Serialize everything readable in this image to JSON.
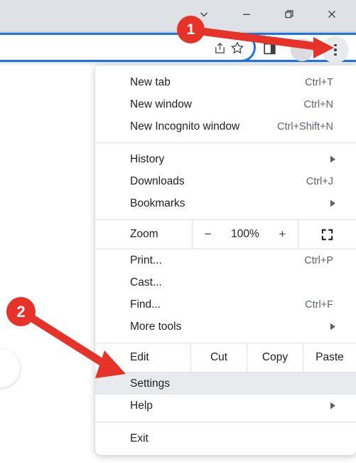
{
  "window_controls": [
    {
      "name": "tab-search-chevron",
      "icon": "chevron-down-icon"
    },
    {
      "name": "minimize",
      "icon": "minimize-icon"
    },
    {
      "name": "restore",
      "icon": "restore-icon"
    },
    {
      "name": "close",
      "icon": "close-icon"
    }
  ],
  "toolbar": {
    "share_icon": "share-icon",
    "bookmark_icon": "star-icon",
    "side_panel_icon": "side-panel-icon",
    "avatar_icon": "profile-avatar-icon",
    "menu_icon": "three-dot-menu-icon"
  },
  "menu": {
    "groups": [
      {
        "items": [
          {
            "label": "New tab",
            "accel": "Ctrl+T",
            "submenu": false
          },
          {
            "label": "New window",
            "accel": "Ctrl+N",
            "submenu": false
          },
          {
            "label": "New Incognito window",
            "accel": "Ctrl+Shift+N",
            "submenu": false
          }
        ]
      },
      {
        "items": [
          {
            "label": "History",
            "accel": "",
            "submenu": true
          },
          {
            "label": "Downloads",
            "accel": "Ctrl+J",
            "submenu": false
          },
          {
            "label": "Bookmarks",
            "accel": "",
            "submenu": true
          }
        ]
      },
      {
        "items": [
          {
            "label": "Print...",
            "accel": "Ctrl+P",
            "submenu": false
          },
          {
            "label": "Cast...",
            "accel": "",
            "submenu": false
          },
          {
            "label": "Find...",
            "accel": "Ctrl+F",
            "submenu": false
          },
          {
            "label": "More tools",
            "accel": "",
            "submenu": true
          }
        ]
      },
      {
        "items": [
          {
            "label": "Settings",
            "accel": "",
            "submenu": false,
            "highlighted": true
          },
          {
            "label": "Help",
            "accel": "",
            "submenu": true
          }
        ]
      },
      {
        "items": [
          {
            "label": "Exit",
            "accel": "",
            "submenu": false
          }
        ]
      }
    ],
    "zoom_row": {
      "label": "Zoom",
      "minus": "−",
      "value": "100%",
      "plus": "+",
      "fullscreen_icon": "fullscreen-icon"
    },
    "edit_row": {
      "label": "Edit",
      "actions": [
        "Cut",
        "Copy",
        "Paste"
      ]
    }
  },
  "annotations": {
    "badges": [
      {
        "id": "1",
        "text": "1"
      },
      {
        "id": "2",
        "text": "2"
      }
    ],
    "accent_color": "#e63329"
  }
}
